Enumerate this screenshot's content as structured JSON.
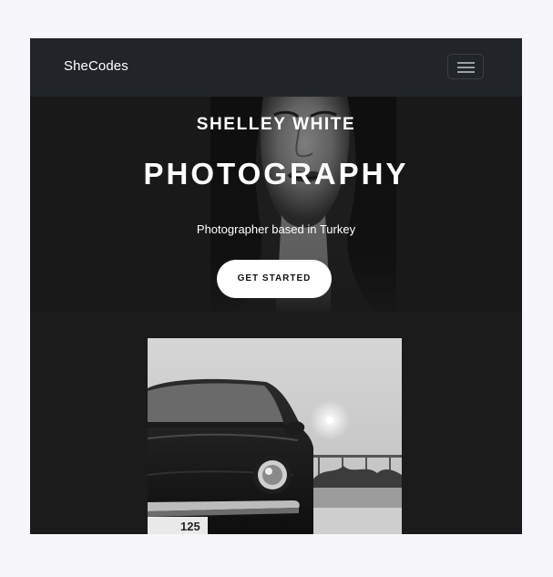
{
  "navbar": {
    "brand": "SheCodes",
    "menu_icon": "hamburger-menu-icon"
  },
  "hero": {
    "subtitle": "SHELLEY WHITE",
    "title": "PHOTOGRAPHY",
    "tagline": "Photographer based in Turkey",
    "cta_label": "GET STARTED"
  },
  "gallery": {
    "images": [
      "portrait-photo",
      "car-photo"
    ],
    "plate_text": "125"
  },
  "colors": {
    "page_bg": "#f7f6fb",
    "navbar_bg": "#212529",
    "hero_bg": "#232323",
    "content_bg": "#1b1b1b",
    "cta_bg": "#ffffff"
  }
}
